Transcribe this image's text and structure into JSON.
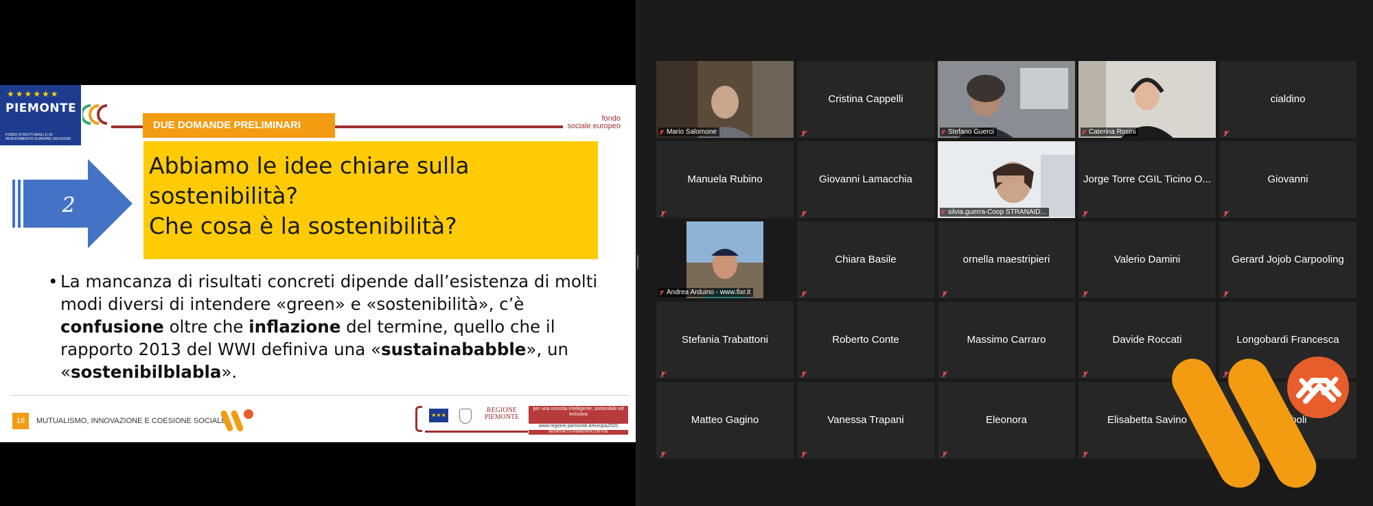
{
  "slide": {
    "logo_text": "PIEMONTE",
    "logo_sub": "FONDI STRUTTURALI E DI INVESTIMENTO EUROPEI 2014/2020",
    "fse_line1": "fondo",
    "fse_line2": "sociale europeo",
    "header_tag": "DUE DOMANDE PRELIMINARI",
    "arrow_number": "2",
    "question": "Abbiamo le idee chiare sulla\nsostenibilità?\nChe cosa è la sostenibilità?",
    "bullet_part1": "La mancanza di risultati concreti dipende dall’esistenza di molti modi diversi di intendere «green» e «sostenibilità», c’è ",
    "bullet_bold1": "confusione",
    "bullet_part2": " oltre che ",
    "bullet_bold2": "inflazione",
    "bullet_part3": " del termine, quello che il rapporto 2013 del WWI definiva una «",
    "bullet_bold3": "sustainababble",
    "bullet_part4": "», un «",
    "bullet_bold4": "sostenibilblabla",
    "bullet_part5": "».",
    "slide_number": "16",
    "footer_title": "MUTUALISMO, INNOVAZIONE E COESIONE SOCIALE",
    "regione_text": "REGIONE PIEMONTE",
    "redbox_text": "per una crescita intelligente, sostenibile ed inclusiva",
    "url_text": "www.regione.piemonte.it/europa2020",
    "cofin_text": "INIZIATIVA CO-FINANZIATA CON FSE"
  },
  "participants": [
    {
      "name": "Mario Salomone",
      "video": true,
      "speaking": true,
      "pinned": true
    },
    {
      "name": "Cristina Cappelli",
      "video": false
    },
    {
      "name": "Stefano Guerci",
      "video": true
    },
    {
      "name": "Caterina Rosini",
      "video": true
    },
    {
      "name": "cialdino",
      "video": false
    },
    {
      "name": "Manuela Rubino",
      "video": false
    },
    {
      "name": "Giovanni Lamacchia",
      "video": false
    },
    {
      "name": "silvia.guerra-Coop STRANAID...",
      "video": true
    },
    {
      "name": "Jorge Torre CGIL Ticino O...",
      "video": false
    },
    {
      "name": "Giovanni",
      "video": false
    },
    {
      "name": "Andrea Arduino - www.fixr.it",
      "video": true
    },
    {
      "name": "Chiara Basile",
      "video": false
    },
    {
      "name": "ornella maestripieri",
      "video": false
    },
    {
      "name": "Valerio Damini",
      "video": false
    },
    {
      "name": "Gerard Jojob Carpooling",
      "video": false
    },
    {
      "name": "Stefania Trabattoni",
      "video": false
    },
    {
      "name": "Roberto Conte",
      "video": false
    },
    {
      "name": "Massimo Carraro",
      "video": false
    },
    {
      "name": "Davide Roccati",
      "video": false
    },
    {
      "name": "Longobardi Francesca",
      "video": false
    },
    {
      "name": "Matteo Gagino",
      "video": false
    },
    {
      "name": "Vanessa Trapani",
      "video": false
    },
    {
      "name": "Eleonora",
      "video": false
    },
    {
      "name": "Elisabetta Savino",
      "video": false
    },
    {
      "name": "Crimboli",
      "video": false
    }
  ],
  "colors": {
    "speaking_border": "#d8f06a",
    "slide_accent": "#f39c12",
    "question_bg": "#ffcb05",
    "brand_orange": "#f39c12"
  }
}
